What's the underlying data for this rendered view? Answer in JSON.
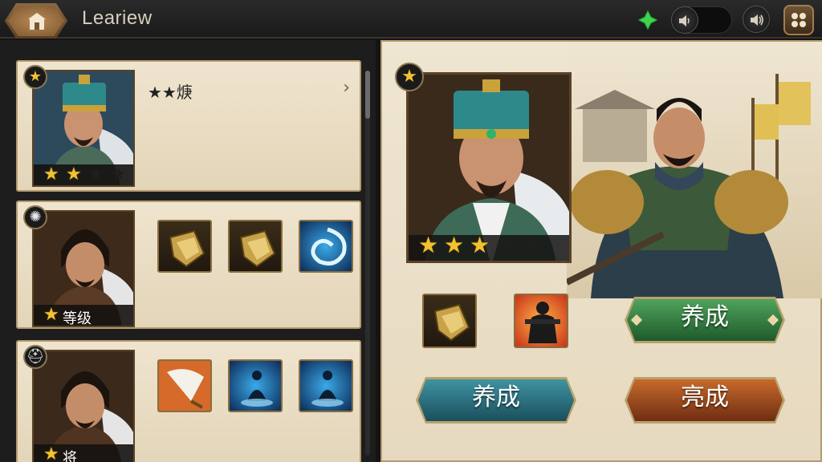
{
  "header": {
    "title": "Leariew",
    "icons": [
      "home-hex-icon",
      "green-gem-icon",
      "sound-low-icon",
      "sound-high-icon",
      "menu-grid-icon"
    ]
  },
  "roster": [
    {
      "title": "★★焿",
      "badge_icon": "star-badge-icon",
      "stars_filled": 2,
      "stars_total": 4,
      "rank_label": "",
      "items": []
    },
    {
      "title": "",
      "badge_icon": "rune-badge-icon",
      "stars_filled": 1,
      "stars_total": 1,
      "rank_label": "等级",
      "items": [
        "gauntlet-icon",
        "gauntlet-icon",
        "whirlwind-skill-icon"
      ]
    },
    {
      "title": "",
      "badge_icon": "helmet-badge-icon",
      "stars_filled": 1,
      "stars_total": 1,
      "rank_label": "将",
      "items": [
        "feather-fan-icon",
        "meditation-skill-icon",
        "meditation-skill-icon"
      ]
    }
  ],
  "detail": {
    "badge_icon": "star-badge-icon",
    "stars_filled": 3,
    "stars_total": 5,
    "equipment": [
      "gauntlet-icon",
      "warrior-icon"
    ],
    "buttons": {
      "train_green": "养成",
      "train_teal": "养成",
      "complete_orange": "亮成"
    }
  },
  "colors": {
    "gold_star": "#f2c230",
    "panel_bg": "#efe4ce",
    "green_button": "#2f7a3c",
    "teal_button": "#2a6f7c",
    "orange_button": "#a34a1c"
  }
}
